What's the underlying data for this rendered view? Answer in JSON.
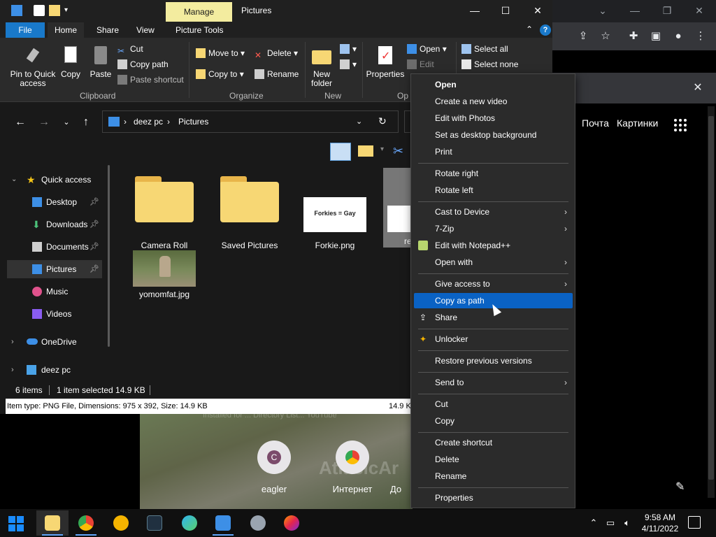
{
  "explorer": {
    "title": "Pictures",
    "manage_tab": "Manage",
    "ribbon_tabs": {
      "file": "File",
      "home": "Home",
      "share": "Share",
      "view": "View",
      "picture_tools": "Picture Tools"
    },
    "ribbon": {
      "pin_label": "Pin to Quick access",
      "copy": "Copy",
      "paste": "Paste",
      "cut": "Cut",
      "copy_path": "Copy path",
      "paste_shortcut": "Paste shortcut",
      "clipboard": "Clipboard",
      "move_to": "Move to",
      "copy_to": "Copy to",
      "delete": "Delete",
      "rename": "Rename",
      "organize": "Organize",
      "new_folder": "New folder",
      "new": "New",
      "properties": "Properties",
      "open": "Open",
      "edit": "Edit",
      "open_group": "Op",
      "select_all": "Select all",
      "select_none": "Select none"
    },
    "address": {
      "pc": "deez pc",
      "folder": "Pictures"
    },
    "nav": {
      "quick_access": "Quick access",
      "desktop": "Desktop",
      "downloads": "Downloads",
      "documents": "Documents",
      "pictures": "Pictures",
      "music": "Music",
      "videos": "Videos",
      "onedrive": "OneDrive",
      "this_pc": "deez pc"
    },
    "files": {
      "camera_roll": "Camera Roll",
      "saved_pictures": "Saved Pictures",
      "forkie": "Forkie.png",
      "forkie_thumb": "Forkies = Gay",
      "partial": "re",
      "yomomfat": "yomomfat.jpg"
    },
    "status": {
      "items": "6 items",
      "selected": "1 item selected  14.9 KB"
    },
    "info_bar": {
      "details": "Item type: PNG File, Dimensions: 975 x 392, Size: 14.9 KB",
      "size_right": "14.9 K"
    }
  },
  "context_menu": {
    "open": "Open",
    "create_video": "Create a new video",
    "edit_photos": "Edit with Photos",
    "set_background": "Set as desktop background",
    "print": "Print",
    "rotate_right": "Rotate right",
    "rotate_left": "Rotate left",
    "cast": "Cast to Device",
    "zip": "7-Zip",
    "notepad": "Edit with Notepad++",
    "open_with": "Open with",
    "give_access": "Give access to",
    "copy_as_path": "Copy as path",
    "share": "Share",
    "unlocker": "Unlocker",
    "restore": "Restore previous versions",
    "send_to": "Send to",
    "cut": "Cut",
    "copy": "Copy",
    "create_shortcut": "Create shortcut",
    "delete": "Delete",
    "rename": "Rename",
    "properties": "Properties"
  },
  "browser": {
    "link_mail": "Почта",
    "link_images": "Картинки",
    "shortcut_eagler": "eagler",
    "shortcut_eagler_letter": "C",
    "shortcut_internet": "Интернет",
    "shortcut_partial": "До",
    "faint_text": "Installed for ...      Directory List...      YouTube",
    "watermark": "AtlasicAr"
  },
  "taskbar": {
    "time": "9:58 AM",
    "date": "4/11/2022"
  },
  "colors": {
    "accent_blue": "#1979ca",
    "menu_highlight": "#0a62c4",
    "manage_yellow": "#f3ec9f",
    "folder_yellow": "#f7d774"
  }
}
